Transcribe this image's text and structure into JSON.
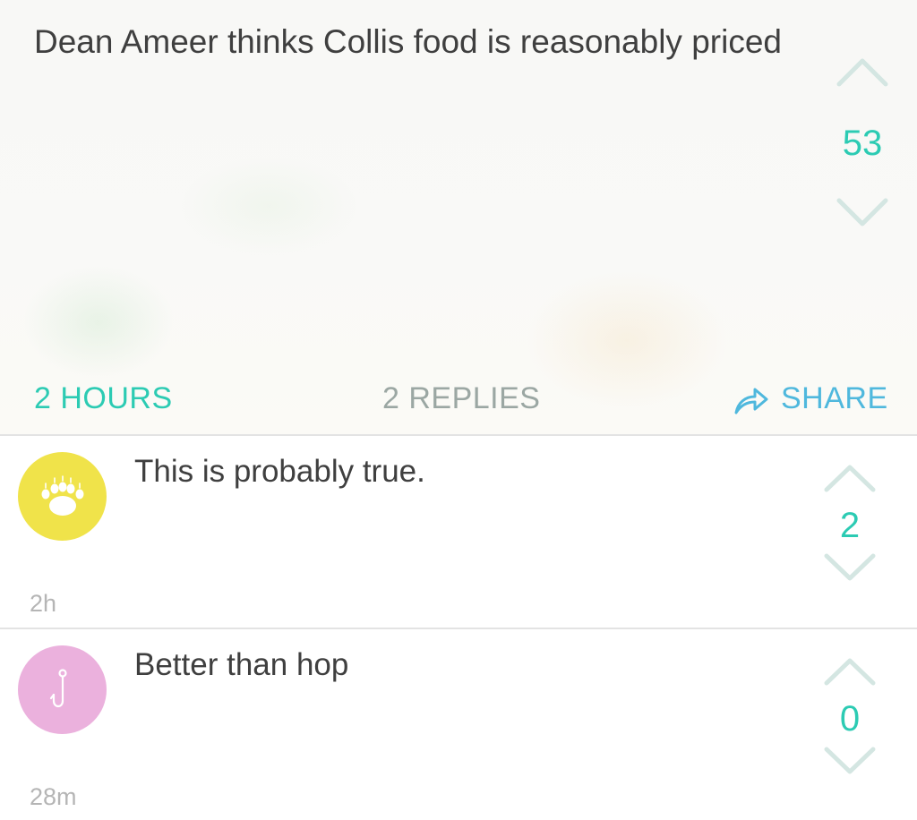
{
  "post": {
    "text": "Dean Ameer thinks Collis food is reasonably priced",
    "score": "53",
    "time": "2 HOURS",
    "replies": "2 REPLIES",
    "share_label": "SHARE",
    "share_icon": "share-arrow-icon"
  },
  "replies": [
    {
      "text": "This is probably true.",
      "time": "2h",
      "score": "2",
      "avatar_icon": "bear-paw-icon",
      "avatar_color": "#f0e34a"
    },
    {
      "text": "Better than hop",
      "time": "28m",
      "score": "0",
      "avatar_icon": "fish-hook-icon",
      "avatar_color": "#ebb1dd"
    }
  ],
  "colors": {
    "accent_teal": "#2ccbb3",
    "share_blue": "#4fb8dd",
    "muted_gray": "#9ba7a3",
    "chevron": "#d4e6e2"
  }
}
